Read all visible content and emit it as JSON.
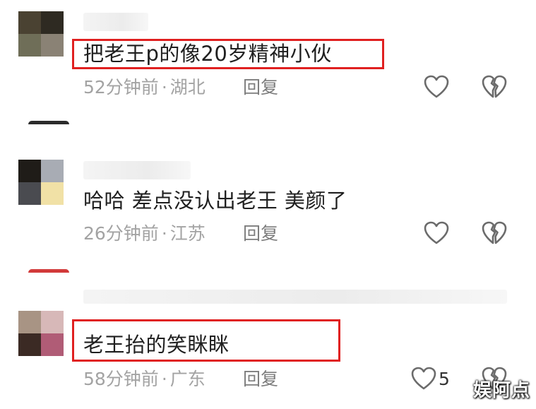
{
  "comments": [
    {
      "text": "把老王p的像20岁精神小伙",
      "time": "52分钟前",
      "location": "湖北",
      "reply_label": "回复",
      "like_count": "",
      "highlighted": true,
      "avatar_colors": [
        "#4a4232",
        "#2e2a22",
        "#6f6e58",
        "#8a8275"
      ]
    },
    {
      "text": "哈哈 差点没认出老王 美颜了",
      "time": "26分钟前",
      "location": "江苏",
      "reply_label": "回复",
      "like_count": "",
      "highlighted": false,
      "avatar_colors": [
        "#1f1c18",
        "#a8acb4",
        "#4a4b50",
        "#f1e1a6"
      ]
    },
    {
      "text": "老王抬的笑眯眯",
      "time": "58分钟前",
      "location": "广东",
      "reply_label": "回复",
      "like_count": "5",
      "highlighted": true,
      "avatar_colors": [
        "#a89484",
        "#d7b8b8",
        "#3b2a24",
        "#b05c76"
      ]
    }
  ],
  "separator_dot": "·",
  "watermark": "娱阿点",
  "colors": {
    "highlight_border": "#e02020",
    "meta_text": "#a3a3a3",
    "icon_stroke": "#6b6b6b"
  },
  "icons": {
    "like": "heart-outline-icon",
    "dislike": "broken-heart-icon"
  }
}
